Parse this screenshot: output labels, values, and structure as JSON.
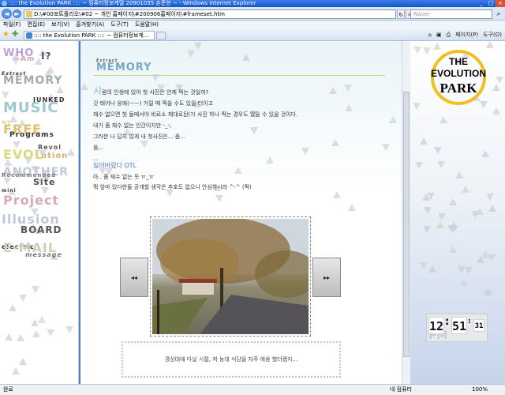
{
  "window": {
    "title": ":::: the Evolution PARK :::: ~ 컴퓨터정보계열 20901035 손준한 ~ - Windows Internet Explorer"
  },
  "addressbar": {
    "url": "D:\\#00포트폴리오\\#02 ~ 개인 홈페이지\\#200906홈페이지\\#frameset.htm",
    "search_placeholder": "Naver"
  },
  "menubar": {
    "items": [
      "파일(F)",
      "편집(E)",
      "보기(V)",
      "즐겨찾기(A)",
      "도구(T)",
      "도움말(H)"
    ]
  },
  "tabs": {
    "active_label": ":::: the Evolution PARK :::: ~ 컴퓨터정보계...",
    "commands": [
      "⌂",
      "▣",
      "⎙",
      "페이지(P)",
      "도구(O)"
    ]
  },
  "left_nav": {
    "items": [
      {
        "text": "WHO",
        "color": "#b8a0d8"
      },
      {
        "text": "Am",
        "color": "#d8a0b8"
      },
      {
        "text": "I?",
        "color": "#555555"
      },
      {
        "text": "Extract",
        "color": "#333333"
      },
      {
        "text": "MEMORY",
        "color": "#9fb0a0"
      },
      {
        "text": "JUNKED",
        "color": "#333333"
      },
      {
        "text": "MUSIC",
        "color": "#9fc9d0"
      },
      {
        "text": "MY",
        "color": "#c8d88a"
      },
      {
        "text": "FREE",
        "color": "#e0c070"
      },
      {
        "text": "Programs",
        "color": "#333333"
      },
      {
        "text": "Revol",
        "color": "#555555"
      },
      {
        "text": "EVOL",
        "color": "#d8d880"
      },
      {
        "text": "ution",
        "color": "#e0b070"
      },
      {
        "text": "ANOTHER",
        "color": "#c0c8d8"
      },
      {
        "text": "Recommended",
        "color": "#777777"
      },
      {
        "text": "Site",
        "color": "#555555"
      },
      {
        "text": "mini",
        "color": "#333333"
      },
      {
        "text": "Project",
        "color": "#d8a8b8"
      },
      {
        "text": "Illusion",
        "color": "#c0c8d8"
      },
      {
        "text": "BOARD",
        "color": "#555555"
      },
      {
        "text": "electric",
        "color": "#333333"
      },
      {
        "text": "E-MAIL",
        "color": "#c8d0b8"
      },
      {
        "text": "message",
        "color": "#777777"
      }
    ]
  },
  "main": {
    "section_kicker": "Extract",
    "section_title": "MEMORY",
    "first_letter": "시",
    "lines": [
      "람의 인생에 있어 첫 사진은 언제 찍는 것일까?",
      "갓 태어나 응애(ㅡㅡ) 거릴 때 찍을 수도 있을 터이고",
      "재수 없으면 첫 돌때서야 비로소 제대로된(?) 사진 하나 찍는 경우도 있을 수 있을 것이다.",
      "내가 좀 재수 없는 인간이지만 -_-;",
      "그러한 나 답지 않게 내 첫사진은... 음...",
      "음...",
      "..."
    ],
    "subtitle": "잃어버렸다 OTL",
    "lines2": [
      "아.. 좀 재수 없는 듯 ㅠ_ㅠ",
      "뭐 앞마 있다한들 공개할 생각은 추호도 없으니 안심하시라 ^-^ (퍽)"
    ],
    "prev_label": "◂◂",
    "next_label": "▸▸",
    "caption": "경상대에 다닐 시절, 저 농대 식당을 자주 애용 했더랬지..."
  },
  "right": {
    "logo": {
      "the": "THE",
      "evolution": "EVOLUTION",
      "park": "PARK",
      "ring_color": "#f0c020"
    },
    "clock": {
      "hours": "12",
      "minutes": "51",
      "seconds": "31",
      "ampm": "PM"
    }
  },
  "statusbar": {
    "left": "완료",
    "zone": "내 컴퓨터",
    "zoom": "100%"
  }
}
